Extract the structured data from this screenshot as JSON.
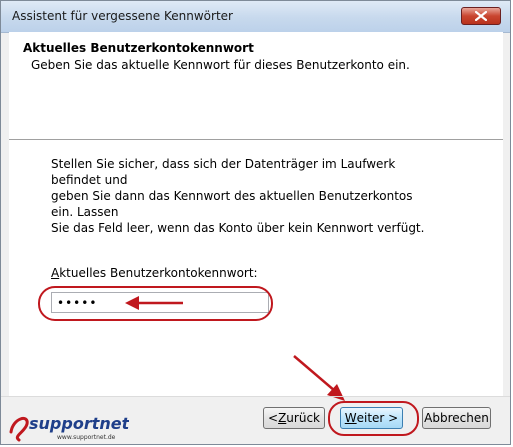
{
  "window": {
    "title": "Assistent für vergessene Kennwörter"
  },
  "header": {
    "title": "Aktuelles Benutzerkontokennwort",
    "subtitle": "Geben Sie das aktuelle Kennwort für dieses Benutzerkonto ein."
  },
  "body": {
    "instructions": [
      "Stellen Sie sicher, dass sich der Datenträger im Laufwerk befindet und",
      "geben Sie dann das Kennwort des aktuellen Benutzerkontos ein. Lassen",
      "Sie das Feld leer, wenn das Konto über kein Kennwort verfügt."
    ],
    "field_label_first": "A",
    "field_label_rest": "ktuelles Benutzerkontokennwort:",
    "password_value": "•••••"
  },
  "buttons": {
    "back_accel": "< ",
    "back_key": "Z",
    "back_rest": "urück",
    "next_key": "W",
    "next_rest": "eiter >",
    "cancel": "Abbrechen"
  },
  "logo": {
    "text": "supportnet",
    "url_text": "www.supportnet.de"
  },
  "colors": {
    "annotation": "#c0181e",
    "accent": "#3c7fb1"
  }
}
